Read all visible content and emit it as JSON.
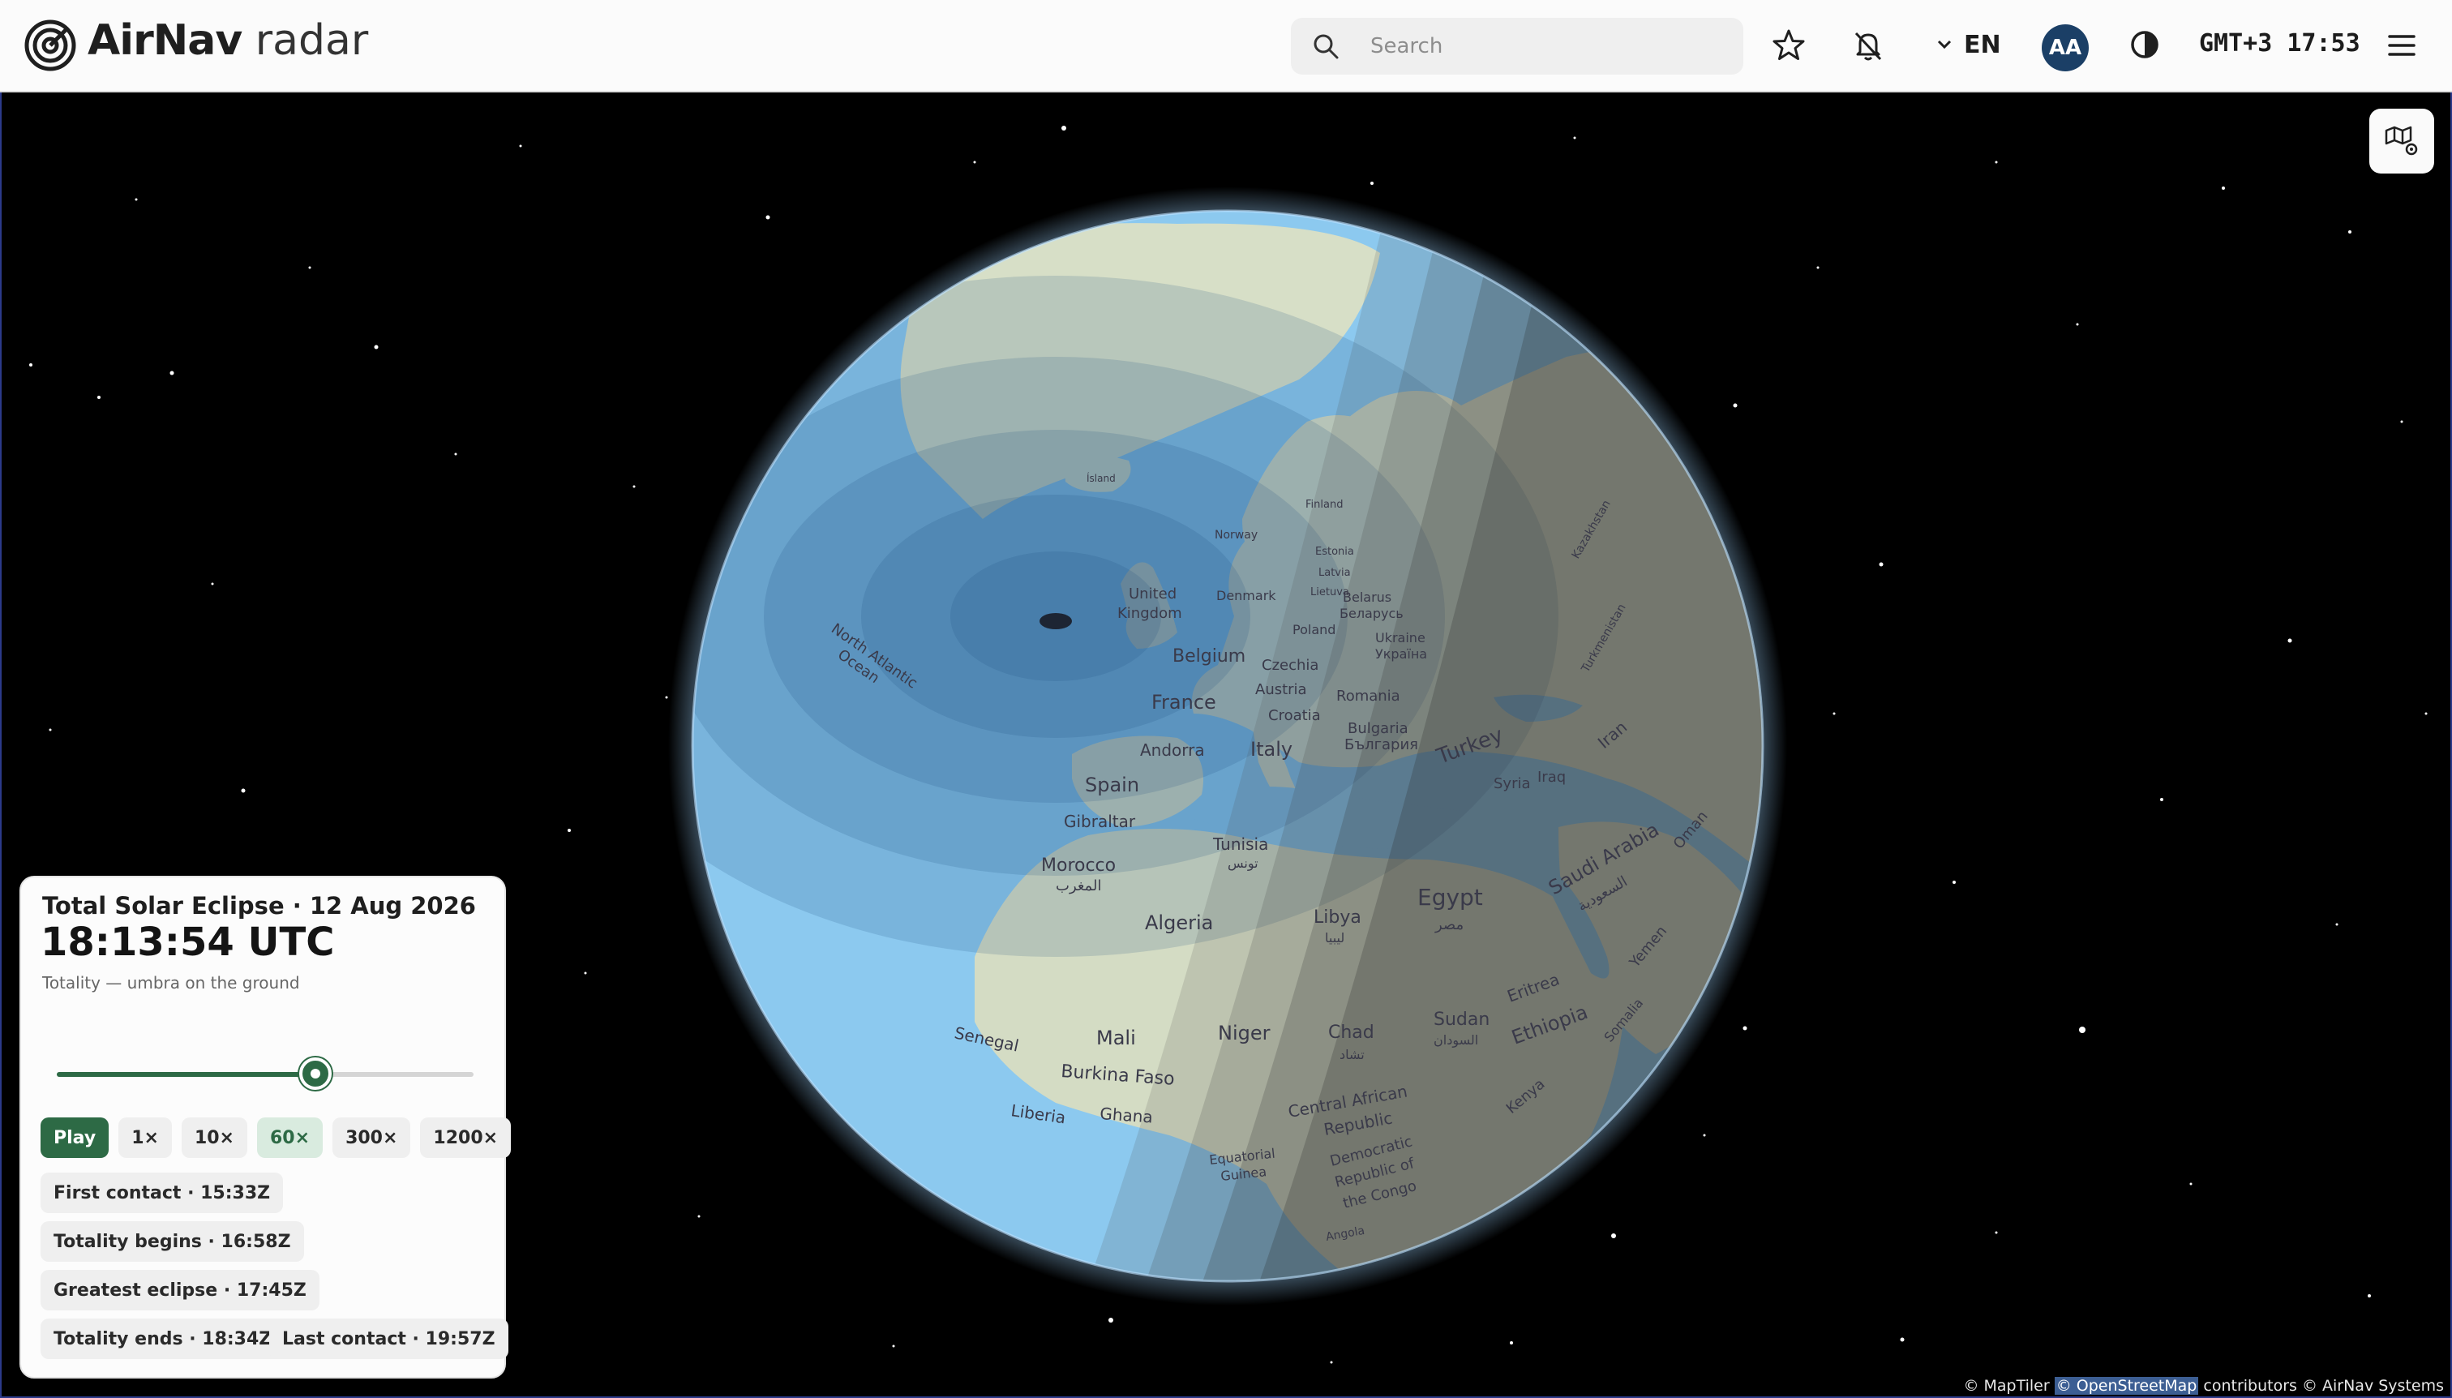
{
  "header": {
    "brand_bold": "AirNav",
    "brand_light": "radar",
    "search_placeholder": "Search",
    "language": "EN",
    "avatar_initials": "AA",
    "clock": "GMT+3 17:53",
    "icons": [
      "radar-logo-icon",
      "search-icon",
      "star-icon",
      "bell-off-icon",
      "chevron-down-icon",
      "contrast-icon",
      "menu-icon"
    ]
  },
  "map": {
    "layers_icon": "map-settings-icon",
    "labels": {
      "north_atlantic": "North Atlantic",
      "ocean": "Ocean",
      "united": "United",
      "kingdom": "Kingdom",
      "denmark": "Denmark",
      "norway": "Norway",
      "iceland": "Ísland",
      "finland": "Finland",
      "estonia": "Estonia",
      "latvia": "Latvia",
      "lithuania": "Lietuva",
      "belarus": "Belarus",
      "belarus_local": "Беларусь",
      "poland": "Poland",
      "ukraine": "Ukraine",
      "ukraine_local": "Україна",
      "belgium": "Belgium",
      "czechia": "Czechia",
      "austria": "Austria",
      "romania": "Romania",
      "croatia": "Croatia",
      "france": "France",
      "bulgaria": "Bulgaria",
      "bulgaria_local": "България",
      "andorra": "Andorra",
      "italy": "Italy",
      "spain": "Spain",
      "gibraltar": "Gibraltar",
      "morocco": "Morocco",
      "morocco_local": "المغرب",
      "tunisia": "Tunisia",
      "tunisia_local": "تونس",
      "algeria": "Algeria",
      "libya": "Libya",
      "libya_local": "ليبيا",
      "egypt": "Egypt",
      "egypt_local": "مصر",
      "turkey": "Turkey",
      "syria": "Syria",
      "iraq": "Iraq",
      "iran": "Iran",
      "saudi": "Saudi Arabia",
      "saudi_local": "السعودية",
      "senegal": "Senegal",
      "mali": "Mali",
      "niger": "Niger",
      "chad": "Chad",
      "chad_local": "تشاد",
      "sudan": "Sudan",
      "sudan_local": "السودان",
      "eritrea": "Eritrea",
      "ethiopia": "Ethiopia",
      "burkina": "Burkina Faso",
      "ghana": "Ghana",
      "liberia": "Liberia",
      "car1": "Central African",
      "car2": "Republic",
      "eq1": "Equatorial",
      "eq2": "Guinea",
      "drc1": "Democratic",
      "drc2": "Republic of",
      "drc3": "the Congo",
      "kenya": "Kenya",
      "yemen": "Yemen",
      "oman": "Oman",
      "somalia": "Somalia",
      "turkmenistan": "Turkmenistan",
      "kazakhstan": "Kazakhstan",
      "angola": "Angola"
    }
  },
  "panel": {
    "title": "Total Solar Eclipse · 12 Aug 2026",
    "time": "18:13:54 UTC",
    "subtitle": "Totality — umbra on the ground",
    "progress": 0.62,
    "play_label": "Play",
    "speeds": [
      "1×",
      "10×",
      "60×",
      "300×",
      "1200×"
    ],
    "active_speed": "60×",
    "contacts": {
      "first": "First contact · 15:33Z",
      "totality_begins": "Totality begins · 16:58Z",
      "greatest": "Greatest eclipse · 17:45Z",
      "totality_ends": "Totality ends · 18:34Z",
      "last": "Last contact · 19:57Z"
    }
  },
  "attribution": {
    "maptiler": "© MapTiler",
    "osm": "© OpenStreetMap",
    "rest": "contributors © AirNav Systems"
  },
  "colors": {
    "accent_green": "#2d6a45",
    "avatar_blue": "#1b3f66",
    "ocean": "#8cc9ef",
    "land": "#d4dcc4"
  }
}
